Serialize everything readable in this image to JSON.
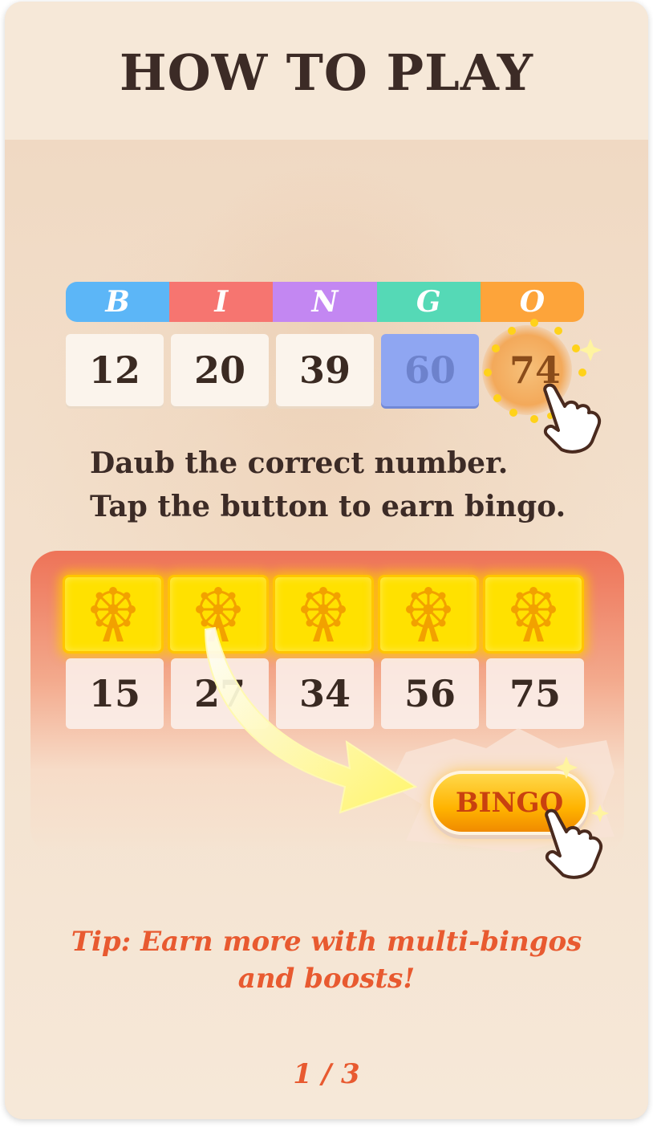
{
  "title": "HOW TO PLAY",
  "bingo_header": [
    {
      "letter": "B",
      "color": "#5cb6f7"
    },
    {
      "letter": "I",
      "color": "#f67570"
    },
    {
      "letter": "N",
      "color": "#c387f2"
    },
    {
      "letter": "G",
      "color": "#55d9b6"
    },
    {
      "letter": "O",
      "color": "#fda43a"
    }
  ],
  "example_row": [
    {
      "number": "12",
      "state": "normal"
    },
    {
      "number": "20",
      "state": "normal"
    },
    {
      "number": "39",
      "state": "normal"
    },
    {
      "number": "60",
      "state": "daubed"
    },
    {
      "number": "74",
      "state": "active"
    }
  ],
  "instructions": {
    "line1": "Daub the correct number.",
    "line2": "Tap the button to earn bingo."
  },
  "bingo_row": [
    "15",
    "27",
    "34",
    "56",
    "75"
  ],
  "gold_tile_icon": "ferris-wheel-icon",
  "bingo_button_label": "BINGO",
  "tip": {
    "line1": "Tip: Earn more with multi-bingos",
    "line2": "and boosts!"
  },
  "page_indicator": "1 / 3",
  "colors": {
    "accent": "#e85a30",
    "gold": "#ffe100",
    "daubed": "#8fa6f2"
  }
}
